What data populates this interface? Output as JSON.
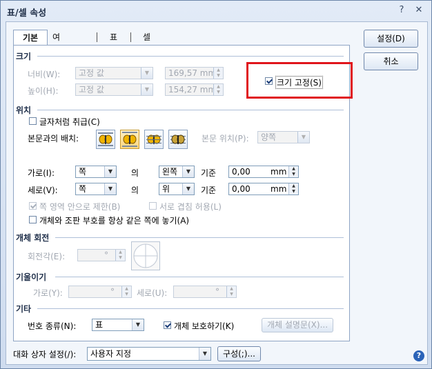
{
  "window": {
    "title": "표/셀 속성",
    "help_glyph": "?",
    "close_glyph": "✕"
  },
  "tabs": [
    {
      "label": "기본"
    },
    {
      "label": "여백/캡션"
    },
    {
      "label": "표"
    },
    {
      "label": "셀"
    }
  ],
  "size": {
    "header": "크기",
    "width_label": "너비(W):",
    "width_mode": "고정 값",
    "width_value": "169,57 mm",
    "height_label": "높이(H):",
    "height_mode": "고정 값",
    "height_value": "154,27 mm",
    "fix_size_label": "크기 고정(S)",
    "fix_size_checked": true
  },
  "position": {
    "header": "위치",
    "treat_as_char_label": "글자처럼 취급(C)",
    "treat_as_char_checked": false,
    "layout_label": "본문과의 배치:",
    "body_position_label": "본문 위치(P):",
    "body_position_value": "양쪽",
    "horiz_label": "가로(I):",
    "horiz_ref": "쪽",
    "of_1": "의",
    "horiz_align": "왼쪽",
    "base_1": "기준",
    "horiz_offset": "0,00",
    "unit_1": "mm",
    "vert_label": "세로(V):",
    "vert_ref": "쪽",
    "of_2": "의",
    "vert_align": "위",
    "base_2": "기준",
    "vert_offset": "0,00",
    "unit_2": "mm",
    "limit_label": "쪽 영역 안으로 제한(B)",
    "limit_checked": true,
    "overlap_label": "서로 겹침 허용(L)",
    "overlap_checked": false,
    "same_page_label": "개체와 조판 부호를 항상 같은 쪽에 놓기(A)",
    "same_page_checked": false
  },
  "rotation": {
    "header": "개체 회전",
    "angle_label": "회전각(E):",
    "angle_unit": "°"
  },
  "skew": {
    "header": "기울이기",
    "h_label": "가로(Y):",
    "h_unit": "°",
    "v_label": "세로(U):",
    "v_unit": "°"
  },
  "etc": {
    "header": "기타",
    "number_type_label": "번호 종류(N):",
    "number_type_value": "표",
    "protect_label": "개체 보호하기(K)",
    "protect_checked": true,
    "description_button": "개체 설명문(X)..."
  },
  "buttons": {
    "ok": "설정(D)",
    "cancel": "취소",
    "compose": "구성(;)..."
  },
  "footer": {
    "dialog_setting_label": "대화 상자 설정(/):",
    "dialog_setting_value": "사용자 지정",
    "help_glyph": "?"
  },
  "colors": {
    "highlight_box": "#e0151b",
    "accent": "#2b63b8"
  }
}
